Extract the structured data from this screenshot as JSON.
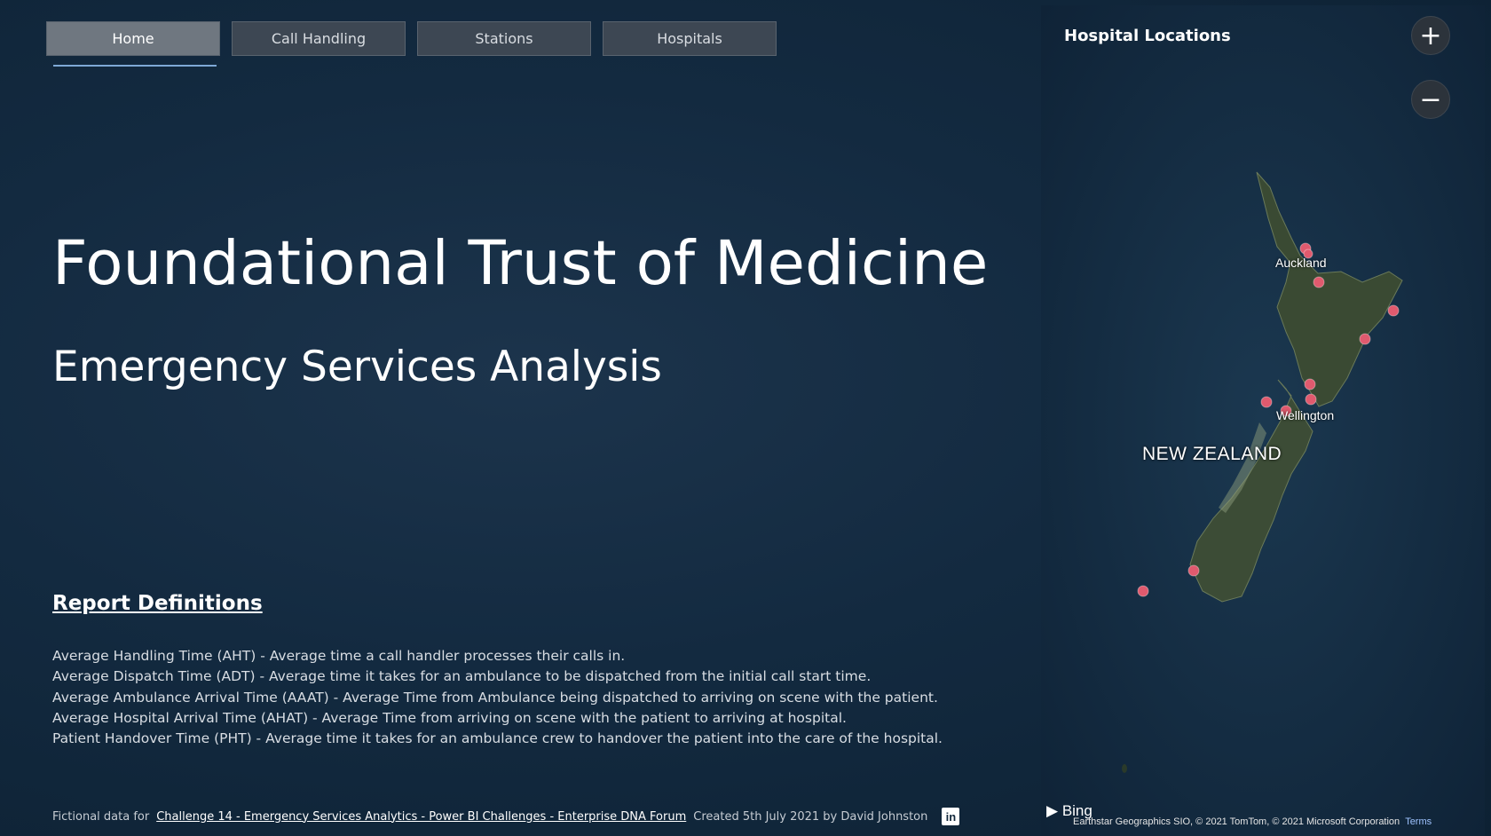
{
  "tabs": [
    {
      "label": "Home",
      "active": true
    },
    {
      "label": "Call Handling",
      "active": false
    },
    {
      "label": "Stations",
      "active": false
    },
    {
      "label": "Hospitals",
      "active": false
    }
  ],
  "title": "Foundational Trust of Medicine",
  "subtitle": "Emergency Services Analysis",
  "definitions": {
    "heading": "Report Definitions",
    "items": [
      "Average Handling Time (AHT) - Average time a call handler processes their calls in.",
      "Average Dispatch Time (ADT) - Average time it takes for an ambulance to be dispatched from the initial call start time.",
      "Average Ambulance Arrival Time (AAAT) - Average Time from Ambulance being dispatched to arriving on scene with the patient.",
      "Average Hospital Arrival Time (AHAT) - Average Time from arriving on scene with the patient to arriving at hospital.",
      "Patient Handover Time (PHT) - Average time it takes for an ambulance crew to handover the patient into the care of the hospital."
    ]
  },
  "footer": {
    "prefix": "Fictional data for",
    "link": "Challenge 14 - Emergency Services Analytics - Power BI Challenges - Enterprise DNA Forum",
    "created": "Created 5th July 2021 by David Johnston",
    "linkedin_icon": "linkedin-icon"
  },
  "map": {
    "title": "Hospital Locations",
    "zoom_in": "+",
    "zoom_out": "−",
    "country_label": "NEW ZEALAND",
    "cities": [
      "Auckland",
      "Wellington"
    ],
    "marker_color": "#e05a6e",
    "provider": "Bing",
    "attribution": "Earthstar Geographics SIO, © 2021 TomTom, © 2021 Microsoft Corporation",
    "terms": "Terms"
  }
}
